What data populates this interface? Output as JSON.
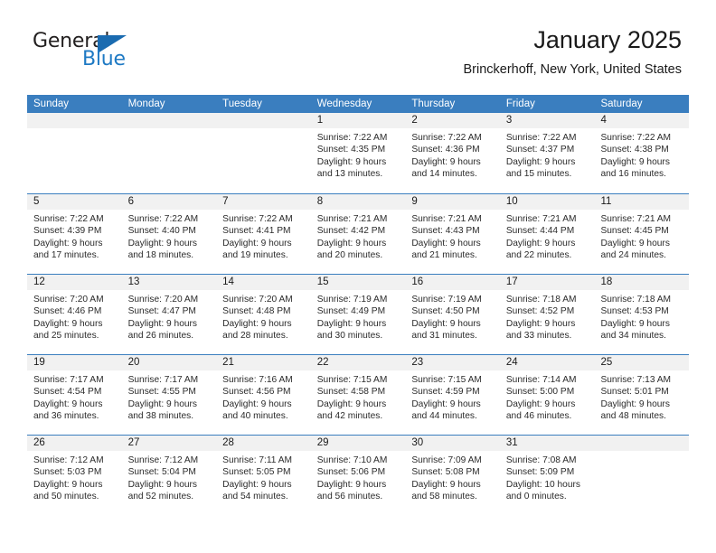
{
  "brand": {
    "name_part1": "General",
    "name_part2": "Blue",
    "triangle_icon": "triangle-icon",
    "accent_color": "#1a6bb0"
  },
  "header": {
    "title": "January 2025",
    "subtitle": "Brinckerhoff, New York, United States"
  },
  "theme": {
    "header_blue": "#3a7ebf",
    "daynum_bg": "#f1f1f1",
    "text_color": "#2b2b2b"
  },
  "weekdays": [
    "Sunday",
    "Monday",
    "Tuesday",
    "Wednesday",
    "Thursday",
    "Friday",
    "Saturday"
  ],
  "labels": {
    "sunrise_prefix": "Sunrise: ",
    "sunset_prefix": "Sunset: ",
    "daylight_prefix": "Daylight: "
  },
  "weeks": [
    [
      {
        "day": "",
        "empty": true
      },
      {
        "day": "",
        "empty": true
      },
      {
        "day": "",
        "empty": true
      },
      {
        "day": "1",
        "sunrise": "Sunrise: 7:22 AM",
        "sunset": "Sunset: 4:35 PM",
        "daylight1": "Daylight: 9 hours",
        "daylight2": "and 13 minutes."
      },
      {
        "day": "2",
        "sunrise": "Sunrise: 7:22 AM",
        "sunset": "Sunset: 4:36 PM",
        "daylight1": "Daylight: 9 hours",
        "daylight2": "and 14 minutes."
      },
      {
        "day": "3",
        "sunrise": "Sunrise: 7:22 AM",
        "sunset": "Sunset: 4:37 PM",
        "daylight1": "Daylight: 9 hours",
        "daylight2": "and 15 minutes."
      },
      {
        "day": "4",
        "sunrise": "Sunrise: 7:22 AM",
        "sunset": "Sunset: 4:38 PM",
        "daylight1": "Daylight: 9 hours",
        "daylight2": "and 16 minutes."
      }
    ],
    [
      {
        "day": "5",
        "sunrise": "Sunrise: 7:22 AM",
        "sunset": "Sunset: 4:39 PM",
        "daylight1": "Daylight: 9 hours",
        "daylight2": "and 17 minutes."
      },
      {
        "day": "6",
        "sunrise": "Sunrise: 7:22 AM",
        "sunset": "Sunset: 4:40 PM",
        "daylight1": "Daylight: 9 hours",
        "daylight2": "and 18 minutes."
      },
      {
        "day": "7",
        "sunrise": "Sunrise: 7:22 AM",
        "sunset": "Sunset: 4:41 PM",
        "daylight1": "Daylight: 9 hours",
        "daylight2": "and 19 minutes."
      },
      {
        "day": "8",
        "sunrise": "Sunrise: 7:21 AM",
        "sunset": "Sunset: 4:42 PM",
        "daylight1": "Daylight: 9 hours",
        "daylight2": "and 20 minutes."
      },
      {
        "day": "9",
        "sunrise": "Sunrise: 7:21 AM",
        "sunset": "Sunset: 4:43 PM",
        "daylight1": "Daylight: 9 hours",
        "daylight2": "and 21 minutes."
      },
      {
        "day": "10",
        "sunrise": "Sunrise: 7:21 AM",
        "sunset": "Sunset: 4:44 PM",
        "daylight1": "Daylight: 9 hours",
        "daylight2": "and 22 minutes."
      },
      {
        "day": "11",
        "sunrise": "Sunrise: 7:21 AM",
        "sunset": "Sunset: 4:45 PM",
        "daylight1": "Daylight: 9 hours",
        "daylight2": "and 24 minutes."
      }
    ],
    [
      {
        "day": "12",
        "sunrise": "Sunrise: 7:20 AM",
        "sunset": "Sunset: 4:46 PM",
        "daylight1": "Daylight: 9 hours",
        "daylight2": "and 25 minutes."
      },
      {
        "day": "13",
        "sunrise": "Sunrise: 7:20 AM",
        "sunset": "Sunset: 4:47 PM",
        "daylight1": "Daylight: 9 hours",
        "daylight2": "and 26 minutes."
      },
      {
        "day": "14",
        "sunrise": "Sunrise: 7:20 AM",
        "sunset": "Sunset: 4:48 PM",
        "daylight1": "Daylight: 9 hours",
        "daylight2": "and 28 minutes."
      },
      {
        "day": "15",
        "sunrise": "Sunrise: 7:19 AM",
        "sunset": "Sunset: 4:49 PM",
        "daylight1": "Daylight: 9 hours",
        "daylight2": "and 30 minutes."
      },
      {
        "day": "16",
        "sunrise": "Sunrise: 7:19 AM",
        "sunset": "Sunset: 4:50 PM",
        "daylight1": "Daylight: 9 hours",
        "daylight2": "and 31 minutes."
      },
      {
        "day": "17",
        "sunrise": "Sunrise: 7:18 AM",
        "sunset": "Sunset: 4:52 PM",
        "daylight1": "Daylight: 9 hours",
        "daylight2": "and 33 minutes."
      },
      {
        "day": "18",
        "sunrise": "Sunrise: 7:18 AM",
        "sunset": "Sunset: 4:53 PM",
        "daylight1": "Daylight: 9 hours",
        "daylight2": "and 34 minutes."
      }
    ],
    [
      {
        "day": "19",
        "sunrise": "Sunrise: 7:17 AM",
        "sunset": "Sunset: 4:54 PM",
        "daylight1": "Daylight: 9 hours",
        "daylight2": "and 36 minutes."
      },
      {
        "day": "20",
        "sunrise": "Sunrise: 7:17 AM",
        "sunset": "Sunset: 4:55 PM",
        "daylight1": "Daylight: 9 hours",
        "daylight2": "and 38 minutes."
      },
      {
        "day": "21",
        "sunrise": "Sunrise: 7:16 AM",
        "sunset": "Sunset: 4:56 PM",
        "daylight1": "Daylight: 9 hours",
        "daylight2": "and 40 minutes."
      },
      {
        "day": "22",
        "sunrise": "Sunrise: 7:15 AM",
        "sunset": "Sunset: 4:58 PM",
        "daylight1": "Daylight: 9 hours",
        "daylight2": "and 42 minutes."
      },
      {
        "day": "23",
        "sunrise": "Sunrise: 7:15 AM",
        "sunset": "Sunset: 4:59 PM",
        "daylight1": "Daylight: 9 hours",
        "daylight2": "and 44 minutes."
      },
      {
        "day": "24",
        "sunrise": "Sunrise: 7:14 AM",
        "sunset": "Sunset: 5:00 PM",
        "daylight1": "Daylight: 9 hours",
        "daylight2": "and 46 minutes."
      },
      {
        "day": "25",
        "sunrise": "Sunrise: 7:13 AM",
        "sunset": "Sunset: 5:01 PM",
        "daylight1": "Daylight: 9 hours",
        "daylight2": "and 48 minutes."
      }
    ],
    [
      {
        "day": "26",
        "sunrise": "Sunrise: 7:12 AM",
        "sunset": "Sunset: 5:03 PM",
        "daylight1": "Daylight: 9 hours",
        "daylight2": "and 50 minutes."
      },
      {
        "day": "27",
        "sunrise": "Sunrise: 7:12 AM",
        "sunset": "Sunset: 5:04 PM",
        "daylight1": "Daylight: 9 hours",
        "daylight2": "and 52 minutes."
      },
      {
        "day": "28",
        "sunrise": "Sunrise: 7:11 AM",
        "sunset": "Sunset: 5:05 PM",
        "daylight1": "Daylight: 9 hours",
        "daylight2": "and 54 minutes."
      },
      {
        "day": "29",
        "sunrise": "Sunrise: 7:10 AM",
        "sunset": "Sunset: 5:06 PM",
        "daylight1": "Daylight: 9 hours",
        "daylight2": "and 56 minutes."
      },
      {
        "day": "30",
        "sunrise": "Sunrise: 7:09 AM",
        "sunset": "Sunset: 5:08 PM",
        "daylight1": "Daylight: 9 hours",
        "daylight2": "and 58 minutes."
      },
      {
        "day": "31",
        "sunrise": "Sunrise: 7:08 AM",
        "sunset": "Sunset: 5:09 PM",
        "daylight1": "Daylight: 10 hours",
        "daylight2": "and 0 minutes."
      },
      {
        "day": "",
        "empty": true
      }
    ]
  ]
}
